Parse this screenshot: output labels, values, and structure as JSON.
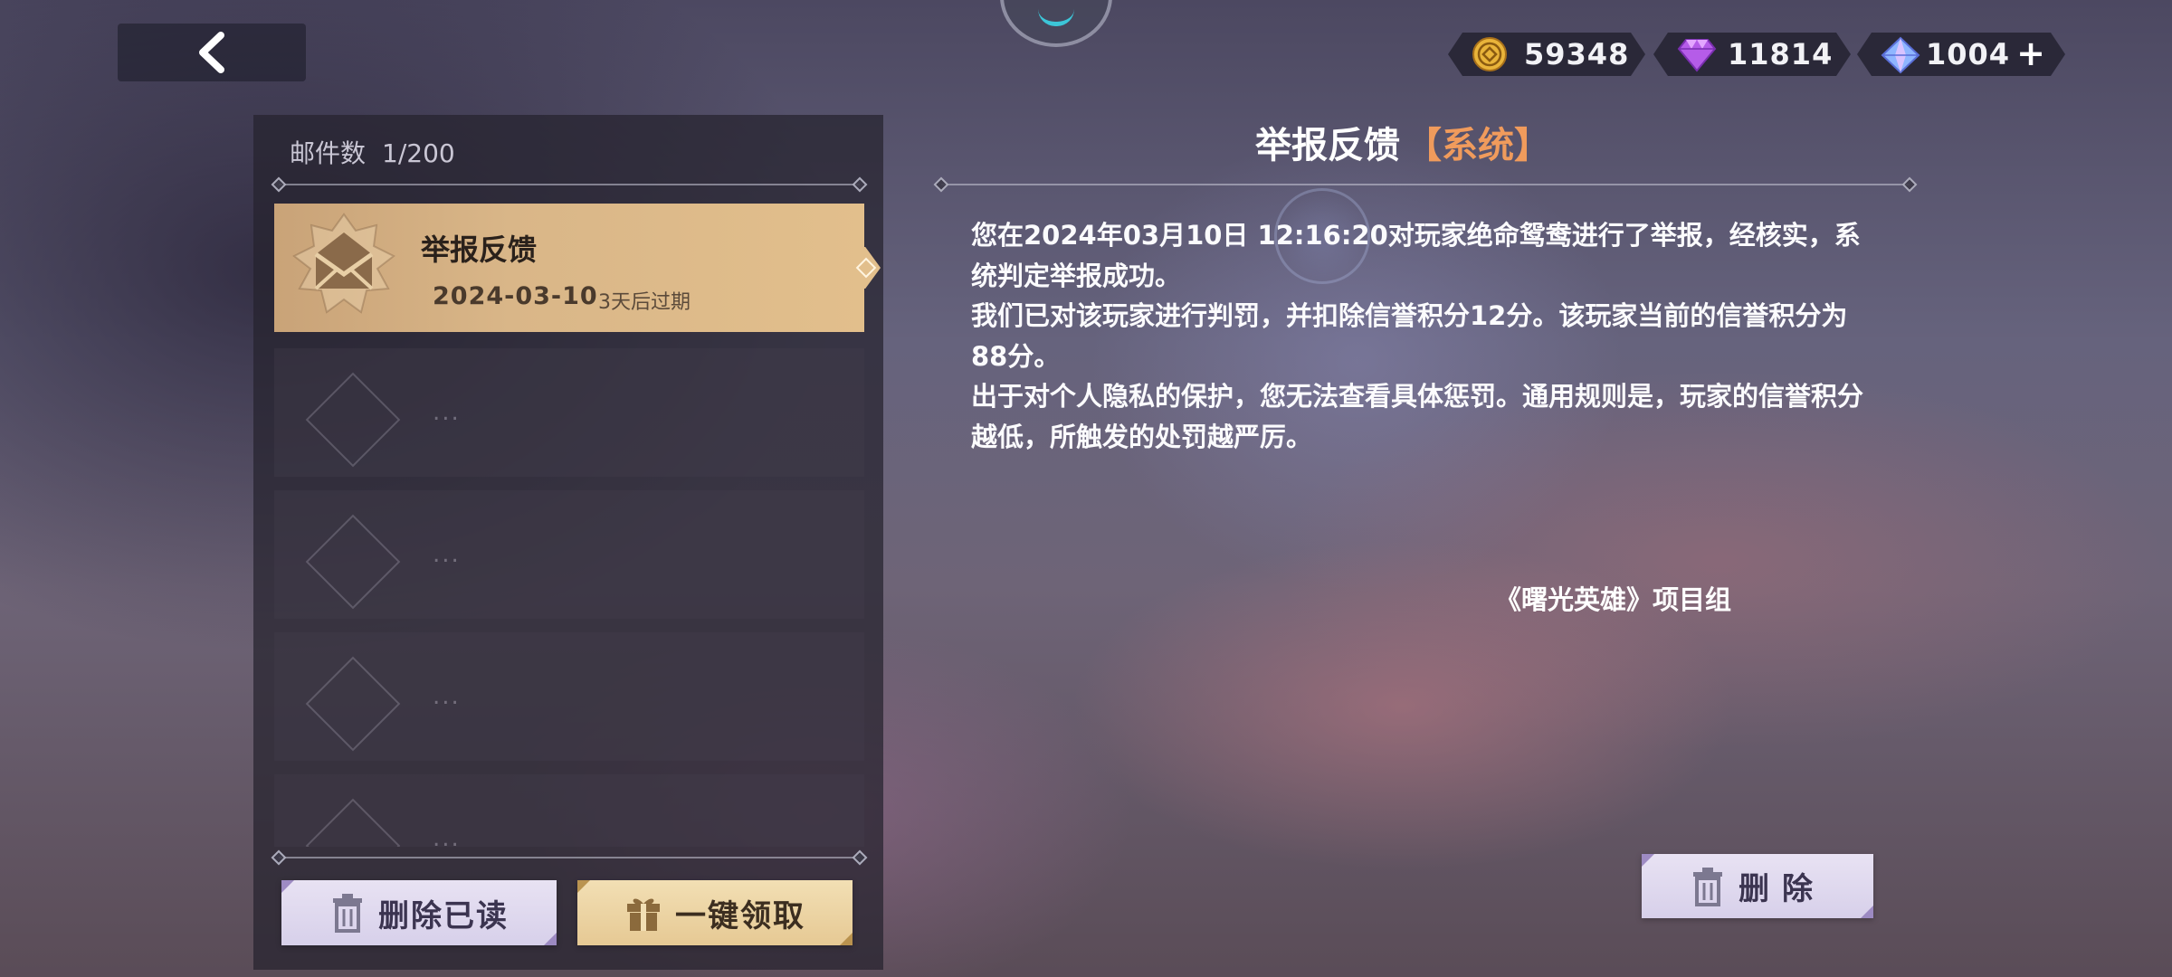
{
  "currencies": [
    {
      "icon": "gold-coin-icon",
      "value": "59348"
    },
    {
      "icon": "purple-gem-icon",
      "value": "11814"
    },
    {
      "icon": "blue-crystal-icon",
      "value": "1004",
      "plus": "+"
    }
  ],
  "mail_list": {
    "count_label": "邮件数",
    "count_value": "1/200",
    "items": [
      {
        "title": "举报反馈",
        "date": "2024-03-10",
        "expire": "3天后过期",
        "selected": true
      },
      {
        "placeholder": "..."
      },
      {
        "placeholder": "..."
      },
      {
        "placeholder": "..."
      },
      {
        "placeholder": "..."
      }
    ],
    "delete_read_label": "删除已读",
    "claim_all_label": "一键领取"
  },
  "detail": {
    "title": "举报反馈",
    "tag": "【系统】",
    "paragraphs": [
      "您在2024年03月10日 12:16:20对玩家绝命鸳鸯进行了举报，经核实，系统判定举报成功。",
      "我们已对该玩家进行判罚，并扣除信誉积分12分。该玩家当前的信誉积分为88分。",
      "出于对个人隐私的保护，您无法查看具体惩罚。通用规则是，玩家的信誉积分越低，所触发的处罚越严厉。"
    ],
    "signature": "《曙光英雄》项目组",
    "delete_label": "删除"
  },
  "colors": {
    "selected_mail": "#d9b688",
    "tag": "#f09b5c",
    "button_lilac": "#ddd6ee",
    "button_gold": "#ecd3a3"
  }
}
